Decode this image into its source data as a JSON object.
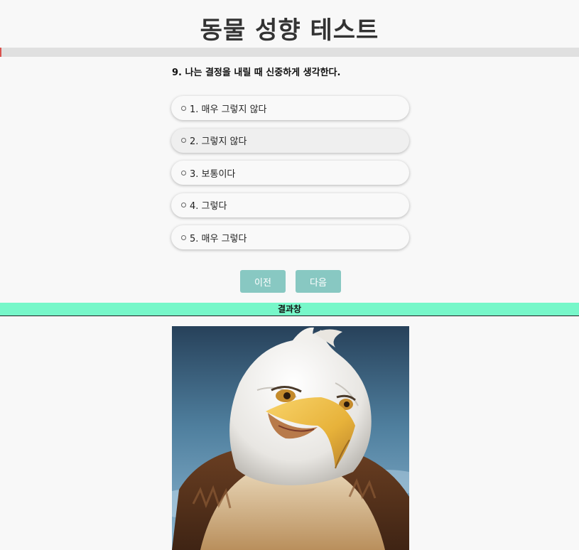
{
  "header": {
    "title": "동물 성향 테스트"
  },
  "progress": {
    "fraction": 0.0
  },
  "question": {
    "text": "9. 나는 결정을 내릴 때 신중하게 생각한다."
  },
  "options": [
    {
      "label": "1. 매우 그렇지 않다"
    },
    {
      "label": "2. 그렇지 않다"
    },
    {
      "label": "3. 보통이다"
    },
    {
      "label": "4. 그렇다"
    },
    {
      "label": "5. 매우 그렇다"
    }
  ],
  "nav": {
    "prev_label": "이전",
    "next_label": "다음"
  },
  "result": {
    "heading": "결과창",
    "image_subject": "eagle-portrait"
  },
  "colors": {
    "button_bg": "#88c8c2",
    "result_bar": "#77f7c9",
    "progress_track": "#e0e0e0",
    "progress_fill": "#d9534f"
  }
}
